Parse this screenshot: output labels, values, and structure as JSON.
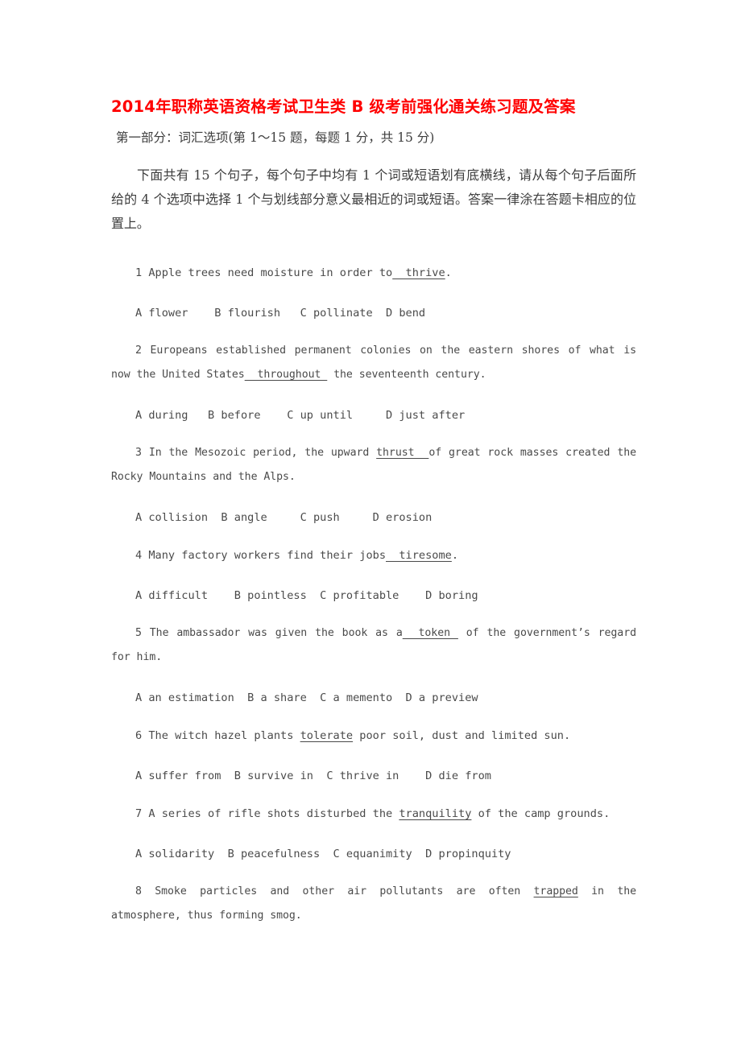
{
  "document": {
    "title": "2014年职称英语资格考试卫生类 B 级考前强化通关练习题及答案",
    "title_color": "#ff0000",
    "section_heading": "第一部分：词汇选项(第 1～15 题，每题 1 分，共 15 分)",
    "intro": "下面共有 15 个句子，每个句子中均有 1 个词或短语划有底横线，请从每个句子后面所给的 4 个选项中选择 1 个与划线部分意义最相近的词或短语。答案一律涂在答题卡相应的位置上。",
    "body_color": "#4a4a4a"
  },
  "questions": [
    {
      "number": "1",
      "stem_before": "1 Apple trees need moisture in order to",
      "stem_underlined": "  thrive",
      "stem_after": ".",
      "wraps": false,
      "options": "A flower    B flourish   C pollinate  D bend"
    },
    {
      "number": "2",
      "stem_before": "2 Europeans established permanent colonies on the eastern shores of what is now the United States",
      "stem_underlined": "  throughout ",
      "stem_after": "  the seventeenth century.",
      "wraps": true,
      "options": "A during   B before    C up until     D just after"
    },
    {
      "number": "3",
      "stem_before": "3 In the Mesozoic period, the upward  ",
      "stem_underlined": "thrust  ",
      "stem_after": "of great rock masses created the Rocky Mountains and the Alps.",
      "wraps": true,
      "options": "A collision  B angle     C push     D erosion"
    },
    {
      "number": "4",
      "stem_before": "4 Many factory workers find their jobs",
      "stem_underlined": "  tiresome",
      "stem_after": ".",
      "wraps": false,
      "options": "A difficult    B pointless  C profitable    D boring"
    },
    {
      "number": "5",
      "stem_before": "5 The ambassador was given the book as a",
      "stem_underlined": "  token ",
      "stem_after": "  of the government’s regard for him.",
      "wraps": true,
      "options": "A an estimation  B a share  C a memento  D a preview"
    },
    {
      "number": "6",
      "stem_before": "6 The witch hazel plants  ",
      "stem_underlined": "tolerate",
      "stem_after": "  poor soil, dust and limited sun.",
      "wraps": false,
      "options": "A suffer from  B survive in  C thrive in    D die from"
    },
    {
      "number": "7",
      "stem_before": "7 A series of rifle shots disturbed the  ",
      "stem_underlined": "tranquility",
      "stem_after": "  of the camp grounds.",
      "wraps": false,
      "options": "A solidarity  B peacefulness  C equanimity  D propinquity"
    },
    {
      "number": "8",
      "stem_before": "8 Smoke particles and other air pollutants are often  ",
      "stem_underlined": "trapped",
      "stem_after": "   in the atmosphere, thus forming smog.",
      "wraps": true,
      "options": ""
    }
  ]
}
